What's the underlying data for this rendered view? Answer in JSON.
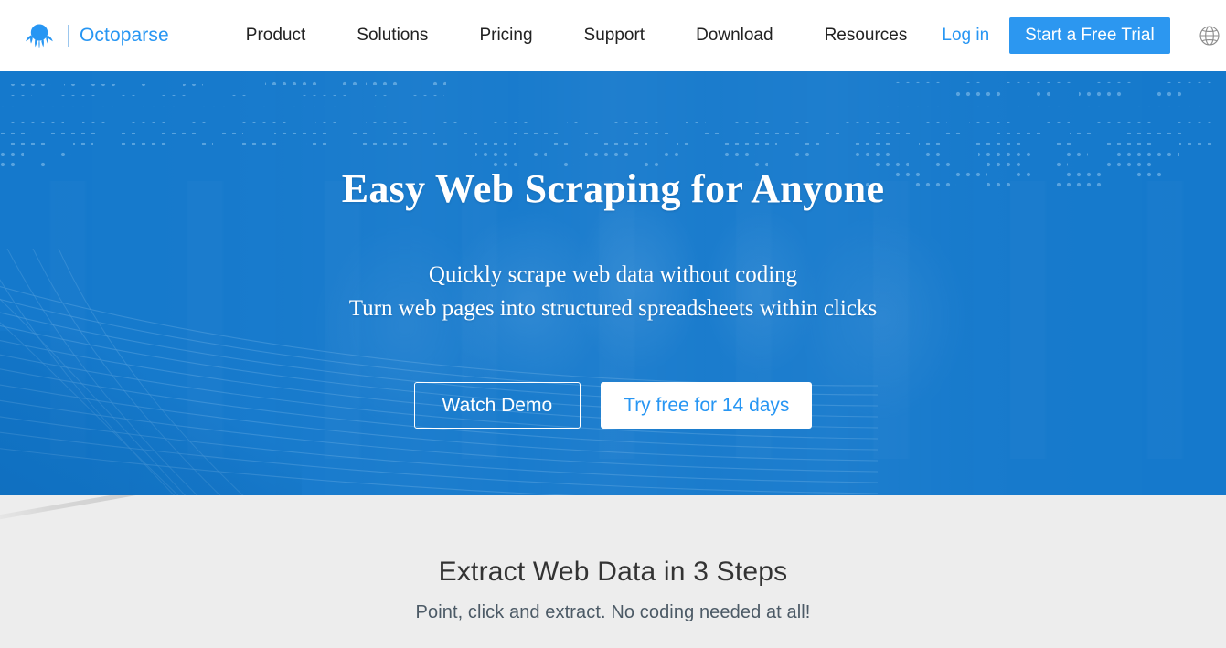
{
  "navbar": {
    "logo_icon": "octopus-logo-icon",
    "brand_name": "Octoparse",
    "links": [
      {
        "label": "Product"
      },
      {
        "label": "Solutions"
      },
      {
        "label": "Pricing"
      },
      {
        "label": "Support"
      },
      {
        "label": "Download"
      },
      {
        "label": "Resources"
      }
    ],
    "login_label": "Log in",
    "trial_button_label": "Start a Free Trial",
    "language_icon": "globe-icon",
    "accent_color": "#2796f3",
    "button_color": "#2c97f0"
  },
  "hero": {
    "title": "Easy Web Scraping for Anyone",
    "subtitle_line1": "Quickly scrape web data without coding",
    "subtitle_line2": "Turn web pages into structured spreadsheets within clicks",
    "demo_button_label": "Watch Demo",
    "trial_button_label": "Try free for 14 days",
    "background_color": "#1579cc"
  },
  "steps": {
    "title": "Extract Web Data in 3 Steps",
    "subtitle": "Point, click and extract. No coding needed at all!",
    "background_color": "#ededed"
  }
}
